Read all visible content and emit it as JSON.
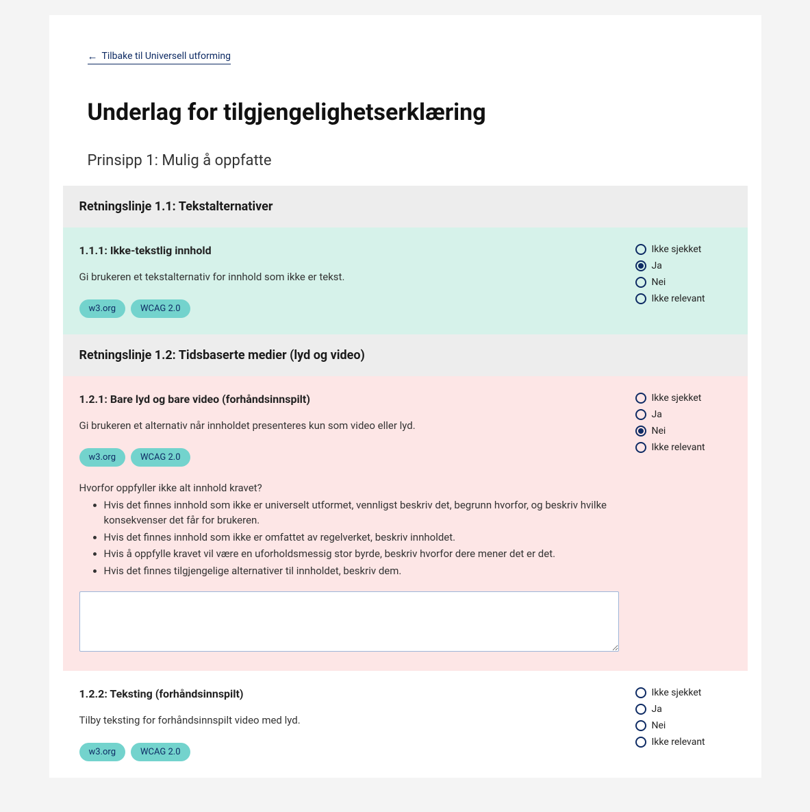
{
  "back_link": "Tilbake til Universell utforming",
  "page_title": "Underlag for tilgjengelighetserklæring",
  "principle_heading": "Prinsipp 1: Mulig å oppfatte",
  "radio_options": [
    "Ikke sjekket",
    "Ja",
    "Nei",
    "Ikke relevant"
  ],
  "tags": {
    "w3": "w3.org",
    "wcag": "WCAG 2.0"
  },
  "followup": {
    "prompt": "Hvorfor oppfyller ikke alt innhold kravet?",
    "bullets": [
      "Hvis det finnes innhold som ikke er universelt utformet, vennligst beskriv det, begrunn hvorfor, og beskriv hvilke konsekvenser det får for brukeren.",
      "Hvis det finnes innhold som ikke er omfattet av regelverket, beskriv innholdet.",
      "Hvis å oppfylle kravet vil være en uforholdsmessig stor byrde, beskriv hvorfor dere mener det er det.",
      "Hvis det finnes tilgjengelige alternativer til innholdet, beskriv dem."
    ]
  },
  "guidelines": [
    {
      "header": "Retningslinje 1.1: Tekstalternativer",
      "criteria": [
        {
          "code": "1.1.1:",
          "name": "Ikke-tekstlig innhold",
          "desc": "Gi brukeren et tekstalternativ for innhold som ikke er tekst.",
          "selected": "Ja"
        }
      ]
    },
    {
      "header": "Retningslinje 1.2: Tidsbaserte medier (lyd og video)",
      "criteria": [
        {
          "code": "1.2.1:",
          "name": "Bare lyd og bare video (forhåndsinnspilt)",
          "desc": "Gi brukeren et alternativ når innholdet presenteres kun som video eller lyd.",
          "selected": "Nei"
        },
        {
          "code": "1.2.2:",
          "name": "Teksting (forhåndsinnspilt)",
          "desc": "Tilby teksting for forhåndsinnspilt video med lyd.",
          "selected": null
        }
      ]
    }
  ]
}
